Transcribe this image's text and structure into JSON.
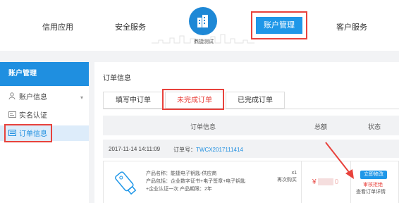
{
  "nav": {
    "items": [
      "信用应用",
      "安全服务",
      "账户管理",
      "客户服务"
    ],
    "logo_text": "鼎捷测试",
    "active_color": "#1f97e8",
    "highlight_color": "#e8423c"
  },
  "sidebar": {
    "title": "账户管理",
    "items": [
      {
        "label": "账户信息",
        "icon": "user-icon"
      },
      {
        "label": "实名认证",
        "icon": "id-card-icon"
      },
      {
        "label": "订单信息",
        "icon": "order-icon"
      }
    ]
  },
  "main": {
    "title": "订单信息",
    "tabs": [
      "填写中订单",
      "未完成订单",
      "已完成订单"
    ],
    "active_tab": "未完成订单",
    "columns": [
      "订单信息",
      "总额",
      "状态"
    ],
    "order": {
      "date": "2017-11-14 14:11:09",
      "no_label": "订单号：",
      "no_value": "TWCX2017111414"
    },
    "product": {
      "name": "产品名称：能捷电子钥匙-供应商",
      "package": "产品包括：企业数字证书+电子签章+电子钥匙",
      "extra": "+企业认证一次  产品期限：2年",
      "qty": "x1",
      "repurchase": "再次购买",
      "price_prefix": "¥",
      "price_suffix": "0",
      "action": "立即修改",
      "status": "审核拒绝",
      "detail": "查看订单详情"
    }
  }
}
